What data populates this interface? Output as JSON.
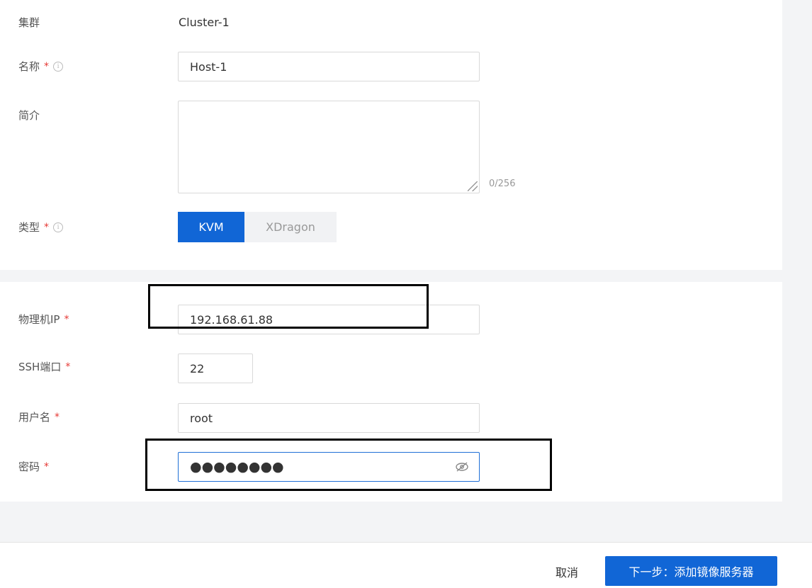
{
  "form": {
    "cluster": {
      "label": "集群",
      "value": "Cluster-1"
    },
    "name": {
      "label": "名称",
      "required_mark": "*",
      "value": "Host-1"
    },
    "description": {
      "label": "简介",
      "value": "",
      "counter": "0/256"
    },
    "type": {
      "label": "类型",
      "required_mark": "*",
      "options": [
        "KVM",
        "XDragon"
      ],
      "selected": "KVM"
    },
    "physical_ip": {
      "label": "物理机IP",
      "required_mark": "*",
      "value": "192.168.61.88"
    },
    "ssh_port": {
      "label": "SSH端口",
      "required_mark": "*",
      "value": "22"
    },
    "username": {
      "label": "用户名",
      "required_mark": "*",
      "value": "root"
    },
    "password": {
      "label": "密码",
      "required_mark": "*",
      "masked_value": "●●●●●●●●"
    }
  },
  "footer": {
    "cancel_label": "取消",
    "next_label": "下一步：添加镜像服务器"
  },
  "colors": {
    "accent": "#1166d6",
    "required": "#e53935",
    "highlight_box": "#000000"
  },
  "icons": {
    "info": "info-icon",
    "password_toggle": "eye-slash-icon"
  }
}
